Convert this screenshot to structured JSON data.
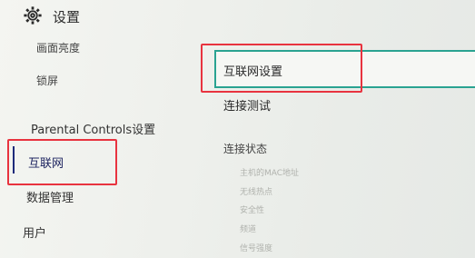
{
  "header": {
    "icon": "gear-icon",
    "title": "设置"
  },
  "sidebar": {
    "items": [
      {
        "label": "画面亮度"
      },
      {
        "label": "锁屏"
      },
      {
        "label": "Parental Controls设置"
      },
      {
        "label": "互联网",
        "selected": true
      },
      {
        "label": "数据管理"
      },
      {
        "label": "用户"
      }
    ]
  },
  "main": {
    "items": [
      {
        "label": "互联网设置",
        "focused": true
      },
      {
        "label": "连接测试"
      }
    ],
    "status_section": {
      "title": "连接状态",
      "fields": [
        {
          "label": "主机的MAC地址"
        },
        {
          "label": "无线热点"
        },
        {
          "label": "安全性"
        },
        {
          "label": "频道"
        },
        {
          "label": "信号强度"
        }
      ]
    }
  },
  "colors": {
    "accent_focus": "#2aa391",
    "selected_bar": "#1d2a7a",
    "annotation": "#e8333f"
  }
}
